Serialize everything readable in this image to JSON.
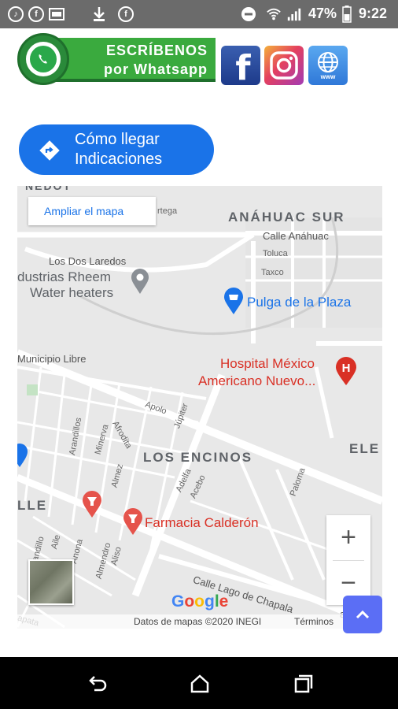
{
  "status_bar": {
    "battery": "47%",
    "time": "9:22",
    "icons": [
      "tiktok-icon",
      "facebook-icon",
      "gallery-icon",
      "download-icon",
      "facebook-icon",
      "do-not-disturb-icon",
      "wifi-icon",
      "signal-icon"
    ]
  },
  "header": {
    "whatsapp_line1": "ESCRÍBENOS",
    "whatsapp_line2": "por Whatsapp",
    "social_icons": [
      "facebook-icon",
      "instagram-icon",
      "globe-www-icon"
    ],
    "www_text": "www",
    "facebook_glyph": "f"
  },
  "directions_button": {
    "line1": "Cómo llegar",
    "line2": "Indicaciones"
  },
  "map": {
    "ampliar": "Ampliar el mapa",
    "areas": {
      "anahuac_sur": "ANÁHUAC SUR",
      "los_encinos": "LOS ENCINOS",
      "ele": "ELE",
      "lle": "LLE",
      "nedot": "NEDOT"
    },
    "streets": {
      "calle_anahuac": "Calle Anáhuac",
      "toluca": "Toluca",
      "taxco": "Taxco",
      "los_dos_laredos": "Los Dos Laredos",
      "municipio_libre": "Municipio Libre",
      "calle_lago": "Calle Lago de Chapala",
      "apolo": "Apolo",
      "jupiter": "Júpiter",
      "afrodita": "Afrodita",
      "minerva": "Minerva",
      "arandillos": "Arandillos",
      "almez": "Almez",
      "adelfa": "Adelfa",
      "acebo": "Acebo",
      "paloma": "Paloma",
      "arandillo": "Arandillo",
      "aile": "Aile",
      "anona": "Anona",
      "almendro": "Almendro",
      "aliso": "Aliso",
      "ortega": "rtega",
      "zapata": "apata",
      "calle_lago_suffix": "a"
    },
    "pois": {
      "rheem_line1": "dustrias Rheem",
      "rheem_line2": "Water heaters",
      "pulga": "Pulga de la Plaza",
      "hospital_line1": "Hospital México",
      "hospital_line2": "Americano Nuevo...",
      "farmacia": "Farmacia Calderón"
    },
    "google": "Google",
    "attribution": "Datos de mapas ©2020 INEGI",
    "terms": "Términos",
    "zoom_in": "+",
    "zoom_out": "−",
    "colors": {
      "poi_blue": "#1a73e8",
      "poi_red": "#d93025",
      "road": "#ffffff",
      "land": "#e8e8e8"
    }
  }
}
